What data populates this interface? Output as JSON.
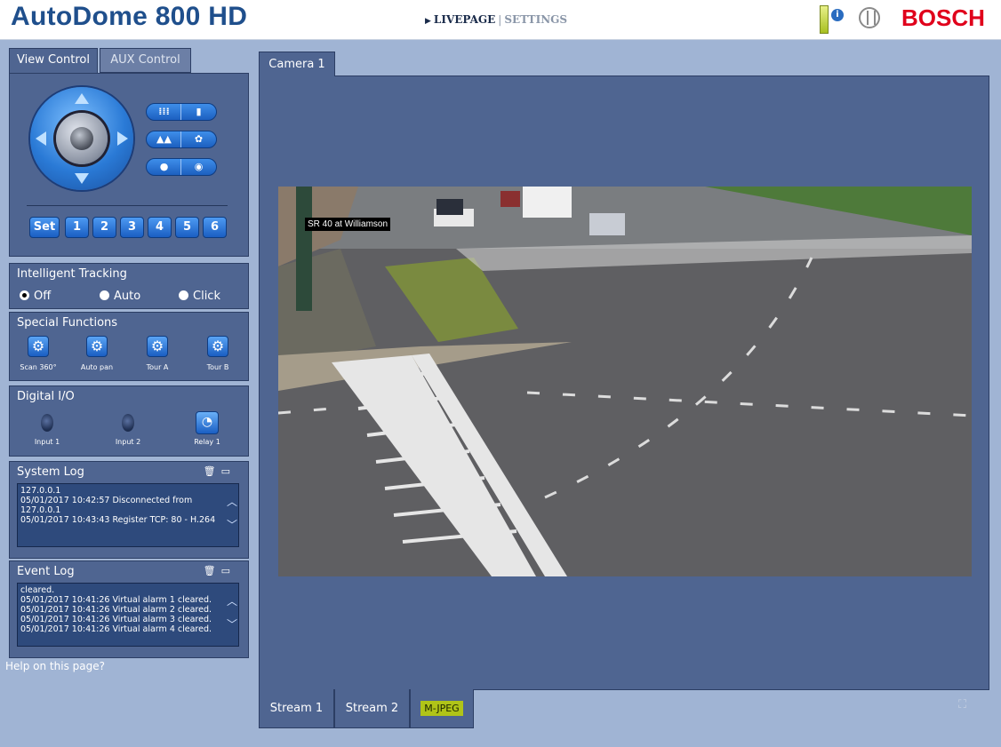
{
  "header": {
    "app_title": "AutoDome 800 HD",
    "nav_livepage": "LIVEPAGE",
    "nav_separator": "|",
    "nav_settings": "SETTINGS",
    "brand": "BOSCH",
    "info_icon": "info-icon",
    "brand_color": "#e0001b",
    "title_color": "#1f4f8c"
  },
  "view_tabs": {
    "view_control": "View Control",
    "aux_control": "AUX Control"
  },
  "view_control": {
    "set_label": "Set",
    "presets": [
      "1",
      "2",
      "3",
      "4",
      "5",
      "6"
    ]
  },
  "intelligent_tracking": {
    "title": "Intelligent Tracking",
    "options": [
      "Off",
      "Auto",
      "Click"
    ],
    "selected": "Off"
  },
  "special_functions": {
    "title": "Special Functions",
    "items": [
      "Scan 360°",
      "Auto pan",
      "Tour A",
      "Tour B"
    ]
  },
  "digital_io": {
    "title": "Digital I/O",
    "input1": "Input 1",
    "input2": "Input 2",
    "relay1": "Relay 1"
  },
  "system_log": {
    "title": "System Log",
    "text": "127.0.0.1\n05/01/2017 10:42:57 Disconnected from 127.0.0.1\n05/01/2017 10:43:43 Register TCP: 80 - H.264"
  },
  "event_log": {
    "title": "Event Log",
    "text": "cleared.\n05/01/2017 10:41:26 Virtual alarm 1 cleared.\n05/01/2017 10:41:26 Virtual alarm 2 cleared.\n05/01/2017 10:41:26 Virtual alarm 3 cleared.\n05/01/2017 10:41:26 Virtual alarm 4 cleared."
  },
  "help": "Help on this page?",
  "camera": {
    "tab": "Camera 1",
    "caption": "SR 40 at Williamson"
  },
  "streams": [
    "Stream 1",
    "Stream 2",
    "M-JPEG"
  ],
  "selected_stream": "M-JPEG"
}
